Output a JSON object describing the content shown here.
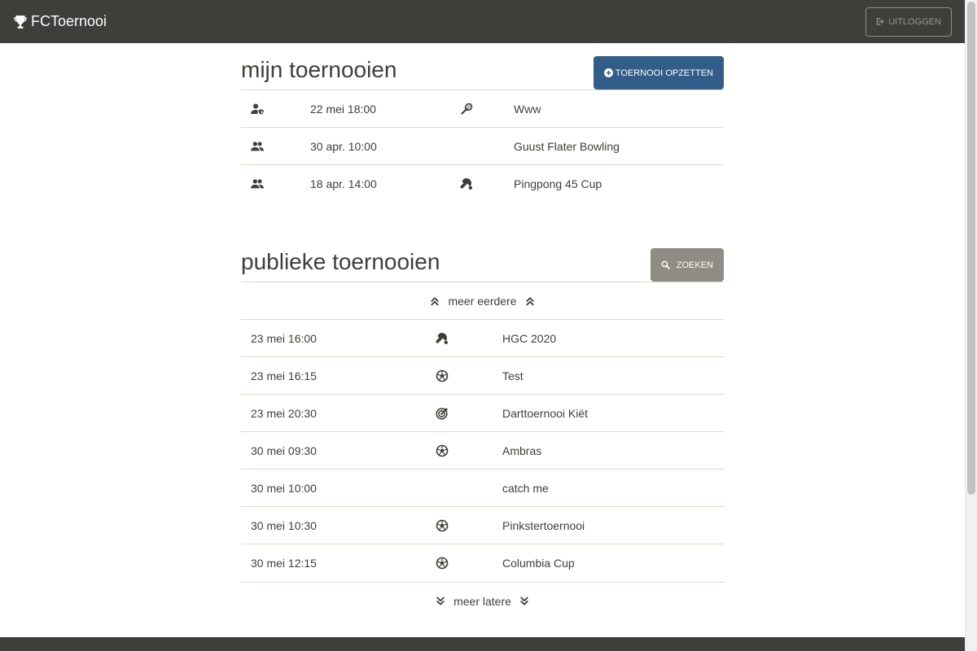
{
  "header": {
    "brand": "FCToernooi",
    "logout_label": "UITLOGGEN"
  },
  "my_tournaments": {
    "title": "mijn toernooien",
    "create_label": "TOERNOOI OPZETTEN",
    "rows": [
      {
        "role_icon": "user-shield-icon",
        "date": "22 mei 18:00",
        "sport_icon": "badminton-icon",
        "name": "Www"
      },
      {
        "role_icon": "users-icon",
        "date": "30 apr. 10:00",
        "sport_icon": "",
        "name": "Guust Flater Bowling"
      },
      {
        "role_icon": "users-icon",
        "date": "18 apr. 14:00",
        "sport_icon": "table-tennis-icon",
        "name": "Pingpong 45 Cup"
      }
    ]
  },
  "public_tournaments": {
    "title": "publieke toernooien",
    "search_label": "ZOEKEN",
    "more_earlier": "meer eerdere",
    "more_later": "meer latere",
    "rows": [
      {
        "date": "23 mei 16:00",
        "sport_icon": "table-tennis-icon",
        "name": "HGC 2020"
      },
      {
        "date": "23 mei 16:15",
        "sport_icon": "football-icon",
        "name": "Test"
      },
      {
        "date": "23 mei 20:30",
        "sport_icon": "darts-icon",
        "name": "Darttoernooi Kiët"
      },
      {
        "date": "30 mei 09:30",
        "sport_icon": "football-icon",
        "name": "Ambras"
      },
      {
        "date": "30 mei 10:00",
        "sport_icon": "",
        "name": "catch me"
      },
      {
        "date": "30 mei 10:30",
        "sport_icon": "football-icon",
        "name": "Pinkstertoernooi"
      },
      {
        "date": "30 mei 12:15",
        "sport_icon": "football-icon",
        "name": "Columbia Cup"
      }
    ]
  },
  "colors": {
    "navbar": "#3e3f3a",
    "primary": "#325d88",
    "secondary": "#8e8c84",
    "border": "#dfd7ca"
  }
}
